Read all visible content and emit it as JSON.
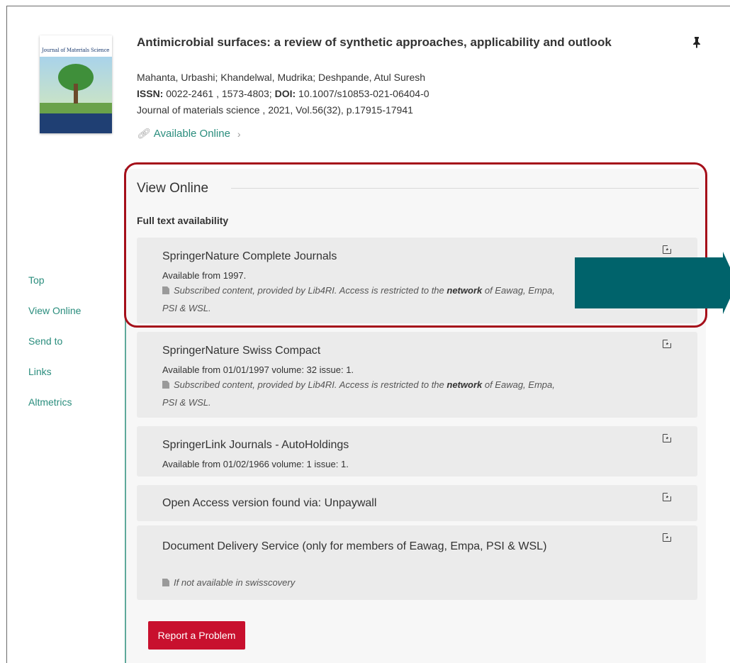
{
  "record": {
    "cover_title": "Journal of Materials Science",
    "title": "Antimicrobial surfaces: a review of synthetic approaches, applicability and outlook",
    "authors": "Mahanta, Urbashi; Khandelwal, Mudrika; Deshpande, Atul Suresh",
    "issn_label": "ISSN:",
    "issn_value": " 0022-2461 , 1573-4803; ",
    "doi_label": "DOI:",
    "doi_value": " 10.1007/s10853-021-06404-0",
    "source": "Journal of materials science , 2021, Vol.56(32), p.17915-17941",
    "availability_label": "Available Online",
    "link_icon": "link-icon",
    "pin_icon": "pin-icon"
  },
  "nav": {
    "items": [
      "Top",
      "View Online",
      "Send to",
      "Links",
      "Altmetrics"
    ]
  },
  "view_online": {
    "title": "View Online",
    "subheading": "Full text availability",
    "services": [
      {
        "name": "SpringerNature Complete Journals",
        "availability": "Available from 1997.",
        "note_prefix": "Subscribed content, provided by Lib4RI. Access is restricted to the ",
        "note_bold": "network",
        "note_suffix": " of Eawag, Empa, PSI & WSL."
      },
      {
        "name": "SpringerNature Swiss Compact",
        "availability": "Available from 01/01/1997 volume: 32 issue: 1.",
        "note_prefix": "Subscribed content, provided by Lib4RI. Access is restricted to the ",
        "note_bold": "network",
        "note_suffix": " of Eawag, Empa, PSI & WSL."
      },
      {
        "name": "SpringerLink Journals - AutoHoldings",
        "availability": "Available from 01/02/1966 volume: 1 issue: 1."
      },
      {
        "name": "Open Access version found via: Unpaywall"
      },
      {
        "name": "Document Delivery Service (only for members of Eawag, Empa, PSI & WSL)",
        "note": "If not available in swisscovery"
      }
    ],
    "report_button": "Report a Problem"
  },
  "colors": {
    "accent_teal": "#2a8d7d",
    "highlight_border": "#a50f1a",
    "arrow": "#00636b",
    "report_button": "#c8102e"
  }
}
